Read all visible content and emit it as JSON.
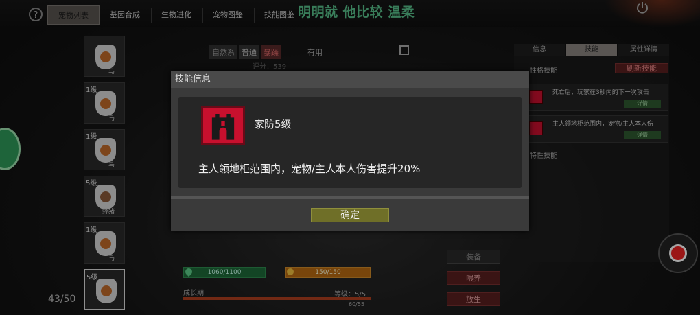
{
  "top": {
    "tabs": [
      "宠物列表",
      "基因合成",
      "生物进化",
      "宠物图鉴",
      "技能图鉴"
    ],
    "headline": "明明就 他比较 温柔"
  },
  "pets": [
    {
      "level": "1级",
      "name": "马"
    },
    {
      "level": "1级",
      "name": "马"
    },
    {
      "level": "1级",
      "name": "马"
    },
    {
      "level": "5级",
      "name": "野猪"
    },
    {
      "level": "1级",
      "name": "马"
    },
    {
      "level": "5级",
      "name": ""
    }
  ],
  "pet_count": "43/50",
  "center": {
    "tags": [
      "自然系",
      "普通",
      "暴躁"
    ],
    "useful": "有用",
    "score": "评分：539",
    "hp": "1060/1100",
    "mp": "150/150",
    "growth_label": "成长期",
    "level_label": "等级：5/5",
    "growth_value": "60/55"
  },
  "actions": {
    "equip": "装备",
    "feed": "喂养",
    "release": "放生"
  },
  "right_panel": {
    "tabs": [
      "信息",
      "技能",
      "属性详情"
    ],
    "personality_label": "性格技能",
    "refresh_button": "刷新技能",
    "skills": [
      {
        "text": "死亡后，玩家在3秒内的下一次攻击",
        "detail": "详情"
      },
      {
        "text": "主人领地柜范围内，宠物/主人本人伤",
        "detail": "详情"
      }
    ],
    "innate_label": "特性技能"
  },
  "modal": {
    "title": "技能信息",
    "skill_name": "家防5级",
    "skill_desc": "主人领地柜范围内，宠物/主人本人伤害提升20%",
    "confirm": "确定"
  }
}
